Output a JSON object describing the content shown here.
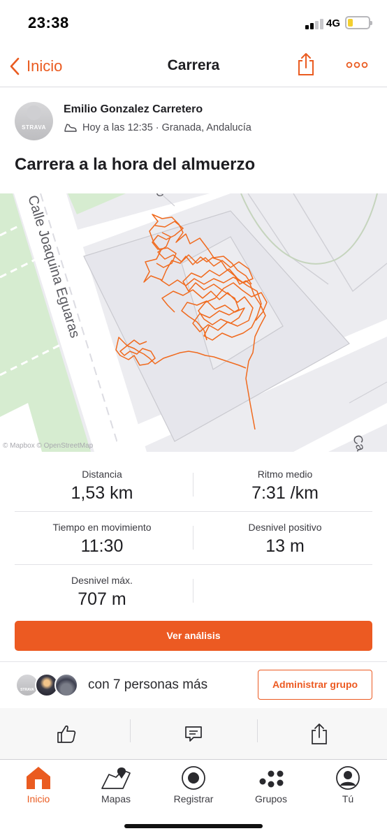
{
  "status_bar": {
    "time": "23:38",
    "network": "4G"
  },
  "nav": {
    "back_label": "Inicio",
    "title": "Carrera",
    "icons": {
      "back": "chevron-left-icon",
      "share": "share-icon",
      "more": "more-horizontal-icon"
    }
  },
  "athlete": {
    "name": "Emilio Gonzalez Carretero",
    "meta": "Hoy a las 12:35 · Granada, Andalucía",
    "avatar_brand": "STRAVA"
  },
  "activity": {
    "title": "Carrera a la hora del almuerzo"
  },
  "map": {
    "street_label": "Calle Joaquina Eguaras",
    "edge_label_top": "C",
    "edge_label_right": "Ca",
    "attribution": "© Mapbox © OpenStreetMap"
  },
  "stats": [
    {
      "label": "Distancia",
      "value": "1,53 km"
    },
    {
      "label": "Ritmo medio",
      "value": "7:31 /km"
    },
    {
      "label": "Tiempo en movimiento",
      "value": "11:30"
    },
    {
      "label": "Desnivel positivo",
      "value": "13 m"
    },
    {
      "label": "Desnivel máx.",
      "value": "707 m"
    }
  ],
  "cta": {
    "label": "Ver análisis"
  },
  "group": {
    "text": "con 7 personas más",
    "button": "Administrar grupo"
  },
  "actions": {
    "like": "thumbs-up-icon",
    "comment": "comment-icon",
    "share": "share-icon"
  },
  "tabs": [
    {
      "label": "Inicio",
      "icon": "home-icon"
    },
    {
      "label": "Mapas",
      "icon": "map-icon"
    },
    {
      "label": "Registrar",
      "icon": "record-icon"
    },
    {
      "label": "Grupos",
      "icon": "groups-icon"
    },
    {
      "label": "Tú",
      "icon": "profile-icon"
    }
  ],
  "colors": {
    "accent": "#ec5a22",
    "route": "#f06a1e",
    "park": "#d6ecd0"
  }
}
